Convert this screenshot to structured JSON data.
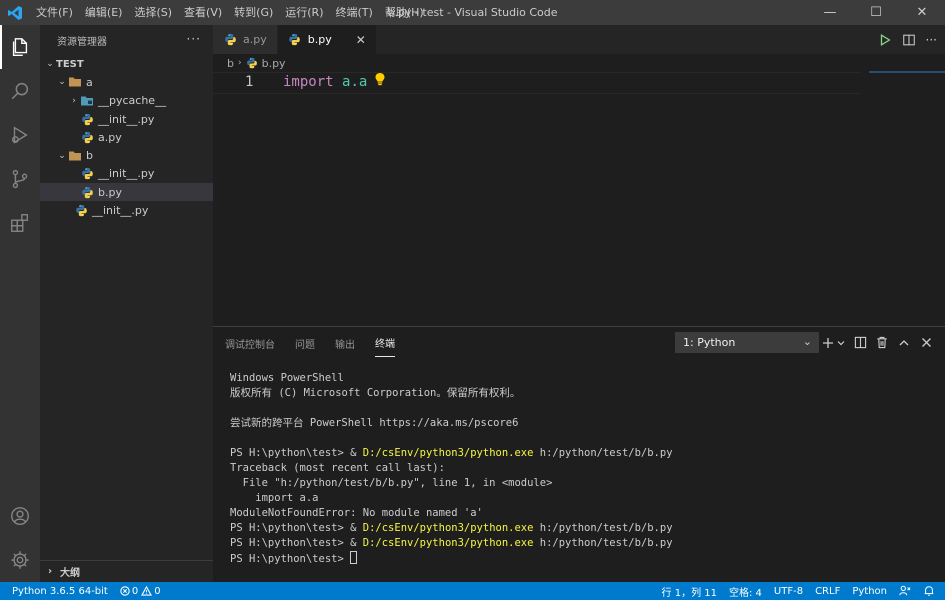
{
  "window": {
    "title": "b.py - test - Visual Studio Code",
    "menu": [
      "文件(F)",
      "编辑(E)",
      "选择(S)",
      "查看(V)",
      "转到(G)",
      "运行(R)",
      "终端(T)",
      "帮助(H)"
    ],
    "controls": {
      "minimize": "—",
      "maximize": "☐",
      "close": "✕"
    }
  },
  "activity_bar": {
    "items": [
      "files-icon",
      "search-icon",
      "run-debug-icon",
      "source-control-icon",
      "extensions-icon"
    ],
    "bottom": [
      "account-icon",
      "settings-gear-icon"
    ]
  },
  "sidebar": {
    "title": "资源管理器",
    "more": "···",
    "tree": [
      {
        "label": "TEST",
        "depth": 0,
        "kind": "root",
        "twisty": "⌄"
      },
      {
        "label": "a",
        "depth": 1,
        "kind": "folder",
        "twisty": "⌄"
      },
      {
        "label": "__pycache__",
        "depth": 2,
        "kind": "folder-special",
        "twisty": "›"
      },
      {
        "label": "__init__.py",
        "depth": 2,
        "kind": "python"
      },
      {
        "label": "a.py",
        "depth": 2,
        "kind": "python"
      },
      {
        "label": "b",
        "depth": 1,
        "kind": "folder",
        "twisty": "⌄"
      },
      {
        "label": "__init__.py",
        "depth": 2,
        "kind": "python"
      },
      {
        "label": "b.py",
        "depth": 2,
        "kind": "python",
        "selected": true
      },
      {
        "label": "__init__.py",
        "depth": 1.5,
        "kind": "python"
      }
    ],
    "outline": "大纲",
    "outline_twisty": "›"
  },
  "editor": {
    "tabs": [
      {
        "label": "a.py",
        "active": false
      },
      {
        "label": "b.py",
        "active": true,
        "close": "✕"
      }
    ],
    "breadcrumb": {
      "folder": "b",
      "sep": "›",
      "file": "b.py"
    },
    "line_number": "1",
    "code": {
      "keyword": "import",
      "module": "a.a"
    }
  },
  "panel": {
    "tabs": [
      "调试控制台",
      "问题",
      "输出",
      "终端"
    ],
    "active_tab": "终端",
    "terminal_select": "1: Python",
    "terminal_select_chevron": "⌄",
    "terminal_lines": [
      {
        "text": "Windows PowerShell"
      },
      {
        "text": "版权所有 (C) Microsoft Corporation。保留所有权利。"
      },
      {
        "text": ""
      },
      {
        "text": "尝试新的跨平台 PowerShell https://aka.ms/pscore6"
      },
      {
        "text": ""
      },
      {
        "prefix": "PS H:\\python\\test> & ",
        "exe": "D:/csEnv/python3/python.exe",
        "suffix": " h:/python/test/b/b.py"
      },
      {
        "text": "Traceback (most recent call last):"
      },
      {
        "text": "  File \"h:/python/test/b/b.py\", line 1, in <module>"
      },
      {
        "text": "    import a.a"
      },
      {
        "text": "ModuleNotFoundError: No module named 'a'"
      },
      {
        "prefix": "PS H:\\python\\test> & ",
        "exe": "D:/csEnv/python3/python.exe",
        "suffix": " h:/python/test/b/b.py"
      },
      {
        "prefix": "PS H:\\python\\test> & ",
        "exe": "D:/csEnv/python3/python.exe",
        "suffix": " h:/python/test/b/b.py"
      },
      {
        "prefix": "PS H:\\python\\test> ",
        "cursor": true
      }
    ]
  },
  "statusbar": {
    "interpreter": "Python 3.6.5 64-bit",
    "errors": "0",
    "warnings": "0",
    "position": "行 1，列 11",
    "spaces": "空格: 4",
    "encoding": "UTF-8",
    "eol": "CRLF",
    "language": "Python"
  },
  "colors": {
    "accent": "#007acc",
    "keyword": "#c586c0",
    "module": "#4ec9b0",
    "terminal_exe": "#f5f543",
    "python_blue": "#3572a5",
    "python_yellow": "#f7d04a"
  }
}
